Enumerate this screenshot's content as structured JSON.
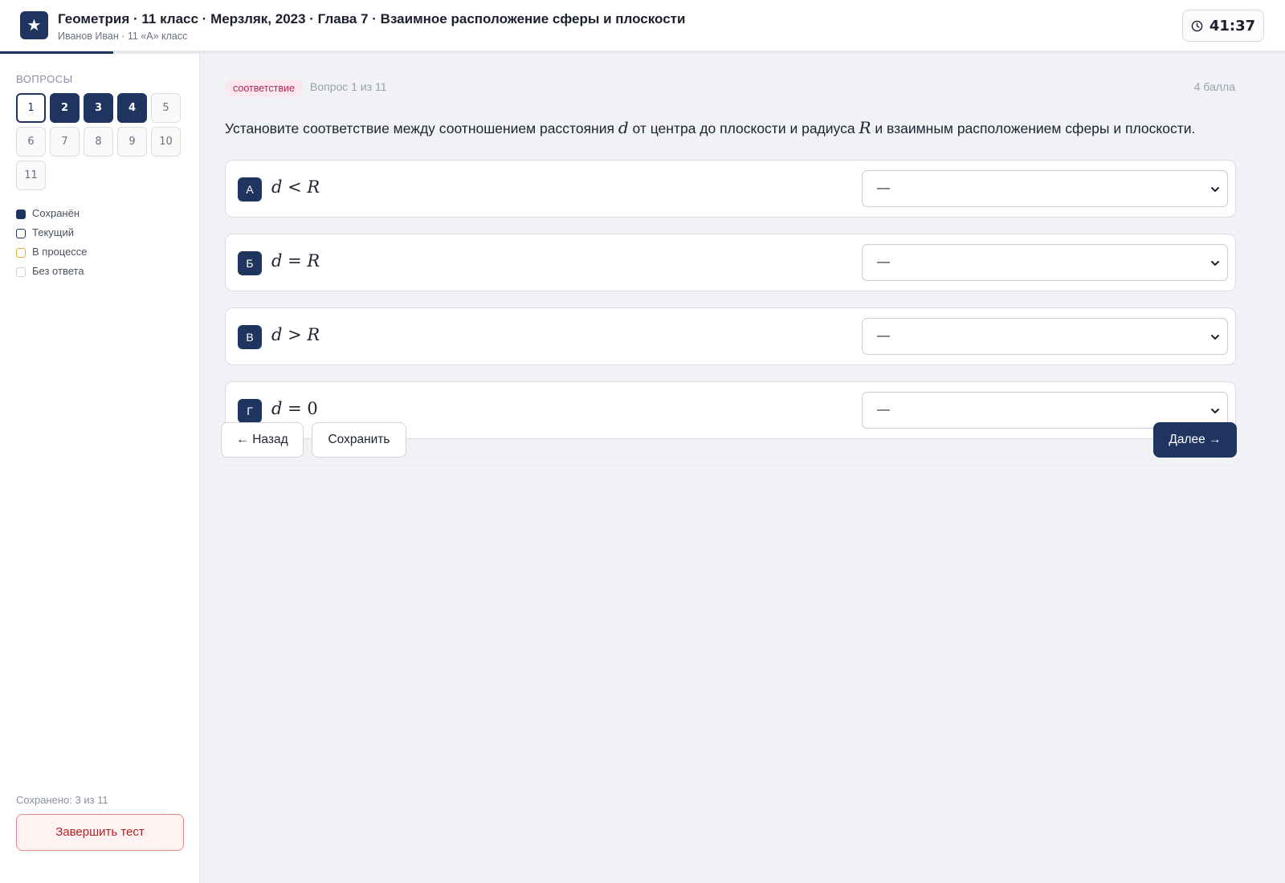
{
  "header": {
    "logo_glyph": "★",
    "title": "Геометрия · 11 класс · Мерзляк, 2023 · Глава 7 · Взаимное расположение сферы и плоскости",
    "subtitle": "Иванов Иван · 11 «А» класс",
    "timer": "41:37",
    "timer_icon": "clock-icon",
    "progress_fraction": 0.088
  },
  "sidebar": {
    "title": "ВОПРОСЫ",
    "questions": [
      {
        "label": "1",
        "state": "current"
      },
      {
        "label": "2",
        "state": "saved"
      },
      {
        "label": "3",
        "state": "saved"
      },
      {
        "label": "4",
        "state": "saved"
      },
      {
        "label": "5",
        "state": "empty"
      },
      {
        "label": "6",
        "state": "empty"
      },
      {
        "label": "7",
        "state": "empty"
      },
      {
        "label": "8",
        "state": "empty"
      },
      {
        "label": "9",
        "state": "empty"
      },
      {
        "label": "10",
        "state": "empty"
      },
      {
        "label": "11",
        "state": "empty"
      }
    ],
    "legend": [
      {
        "label": "Сохранён",
        "kind": "saved"
      },
      {
        "label": "Текущий",
        "kind": "current"
      },
      {
        "label": "В процессе",
        "kind": "progress"
      },
      {
        "label": "Без ответа",
        "kind": "empty"
      }
    ],
    "saved_count": "Сохранено: 3 из 11",
    "finish_label": "Завершить тест"
  },
  "main": {
    "tag": "соответствие",
    "question_number": "Вопрос 1 из 11",
    "points": "4 балла",
    "question_parts": {
      "p1": "Установите соответствие между соотношением расстояния ",
      "var_d": "d",
      "p2": " от центра до плоскости и радиуса ",
      "var_r": "R",
      "p3": " и взаимным расположением сферы и плоскости."
    },
    "rows": [
      {
        "letter": "А",
        "lhs": "d",
        "op": " < ",
        "rhs": "R",
        "selected": "—"
      },
      {
        "letter": "Б",
        "lhs": "d",
        "op": " = ",
        "rhs": "R",
        "selected": "—"
      },
      {
        "letter": "В",
        "lhs": "d",
        "op": " > ",
        "rhs": "R",
        "selected": "—"
      },
      {
        "letter": "Г",
        "lhs": "d",
        "op": " = ",
        "rhs": "0",
        "selected": "—"
      }
    ],
    "back_label": "← Назад",
    "save_label": "Сохранить",
    "next_label": "Далее →"
  },
  "colors": {
    "accent": "#1f3560",
    "tag_bg": "#fbe7ee",
    "tag_text": "#b3264f",
    "in_progress": "#e8a838",
    "finish_border": "#e88a8a"
  }
}
